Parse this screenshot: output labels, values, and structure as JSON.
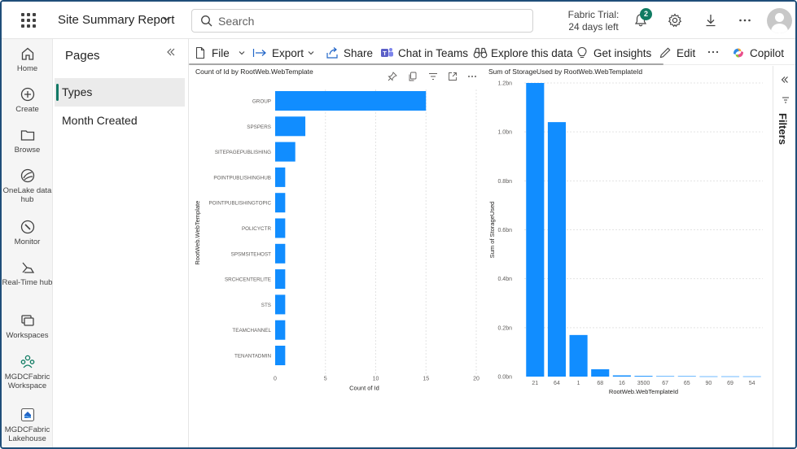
{
  "topbar": {
    "report_title": "Site Summary Report",
    "search_placeholder": "Search",
    "trial_line1": "Fabric Trial:",
    "trial_line2": "24 days left",
    "notifications_count": "2"
  },
  "leftnav": {
    "items": [
      {
        "label": "Home",
        "icon": "home-icon"
      },
      {
        "label": "Create",
        "icon": "create-icon"
      },
      {
        "label": "Browse",
        "icon": "folder-icon"
      },
      {
        "label": "OneLake data hub",
        "icon": "onelake-icon"
      },
      {
        "label": "Monitor",
        "icon": "monitor-icon"
      },
      {
        "label": "Real-Time hub",
        "icon": "realtime-icon"
      },
      {
        "label": "Workspaces",
        "icon": "workspaces-icon"
      },
      {
        "label": "MGDCFabric Workspace",
        "icon": "workspace-icon"
      },
      {
        "label": "MGDCFabric Lakehouse",
        "icon": "lakehouse-icon"
      }
    ]
  },
  "pages": {
    "title": "Pages",
    "items": [
      {
        "label": "Types",
        "active": true
      },
      {
        "label": "Month Created",
        "active": false
      }
    ]
  },
  "actionbar": {
    "file": "File",
    "export": "Export",
    "share": "Share",
    "chat": "Chat in Teams",
    "explore": "Explore this data",
    "insights": "Get insights",
    "edit": "Edit",
    "copilot": "Copilot"
  },
  "filters": {
    "label": "Filters"
  },
  "chart_data": [
    {
      "type": "bar",
      "orientation": "horizontal",
      "title": "Count of Id by RootWeb.WebTemplate",
      "xlabel": "Count of Id",
      "ylabel": "RootWeb.WebTemplate",
      "xlim": [
        0,
        20
      ],
      "xticks": [
        "0",
        "5",
        "10",
        "15",
        "20"
      ],
      "categories": [
        "GROUP",
        "SPSPERS",
        "SITEPAGEPUBLISHING",
        "POINTPUBLISHINGHUB",
        "POINTPUBLISHINGTOPIC",
        "POLICYCTR",
        "SPSMSITEHOST",
        "SRCHCENTERLITE",
        "STS",
        "TEAMCHANNEL",
        "TENANTADMIN"
      ],
      "values": [
        15,
        3,
        2,
        1,
        1,
        1,
        1,
        1,
        1,
        1,
        1
      ],
      "color": "#118DFF",
      "grid": "vertical dashed"
    },
    {
      "type": "bar",
      "orientation": "vertical",
      "title": "Sum of StorageUsed by RootWeb.WebTemplateId",
      "xlabel": "RootWeb.WebTemplateId",
      "ylabel": "Sum of StorageUsed",
      "ylim": [
        0,
        1.2
      ],
      "yunit": "billions",
      "yticks": [
        "0.0bn",
        "0.2bn",
        "0.4bn",
        "0.6bn",
        "0.8bn",
        "1.0bn",
        "1.2bn"
      ],
      "categories": [
        "21",
        "64",
        "1",
        "68",
        "16",
        "3500",
        "67",
        "65",
        "90",
        "69",
        "54"
      ],
      "values": [
        1.2,
        1.04,
        0.17,
        0.03,
        0.005,
        0.003,
        0.002,
        0.002,
        0.001,
        0.001,
        0.001
      ],
      "color": "#118DFF",
      "grid": "horizontal dashed"
    }
  ]
}
